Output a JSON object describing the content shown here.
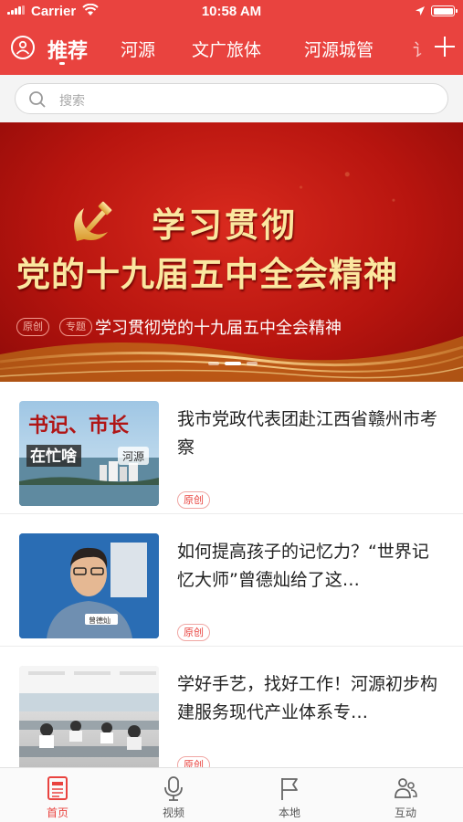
{
  "status_bar": {
    "carrier": "Carrier",
    "time": "10:58 AM"
  },
  "tabs": [
    {
      "label": "推荐",
      "active": true
    },
    {
      "label": "河源"
    },
    {
      "label": "文广旅体"
    },
    {
      "label": "河源城管"
    },
    {
      "label": "讠"
    }
  ],
  "search": {
    "placeholder": "搜索"
  },
  "banner": {
    "headline_line1": "学习贯彻",
    "headline_line2": "党的十九届五中全会精神",
    "tags": [
      "原创",
      "专题"
    ],
    "caption": "学习贯彻党的十九届五中全会精神",
    "slide_count": 3,
    "active_slide": 2
  },
  "news": [
    {
      "title": "我市党政代表团赴江西省赣州市考察",
      "source_tag": "原创",
      "thumb_text": {
        "line1": "书记、市长",
        "line2": "在忙啥",
        "seal": "河源"
      }
    },
    {
      "title": "如何提高孩子的记忆力？“世界记忆大师”曾德灿给了这…",
      "source_tag": "原创",
      "thumb_text": {
        "nameplate": "曾德灿"
      }
    },
    {
      "title": "学好手艺，找好工作！河源初步构建服务现代产业体系专…",
      "source_tag": "原创"
    }
  ],
  "tabbar": [
    {
      "label": "首页",
      "icon": "newspaper-icon",
      "active": true
    },
    {
      "label": "视频",
      "icon": "microphone-icon"
    },
    {
      "label": "本地",
      "icon": "flag-icon"
    },
    {
      "label": "互动",
      "icon": "people-icon"
    }
  ],
  "colors": {
    "accent": "#e9433f",
    "banner_text": "#fbe7a0"
  }
}
